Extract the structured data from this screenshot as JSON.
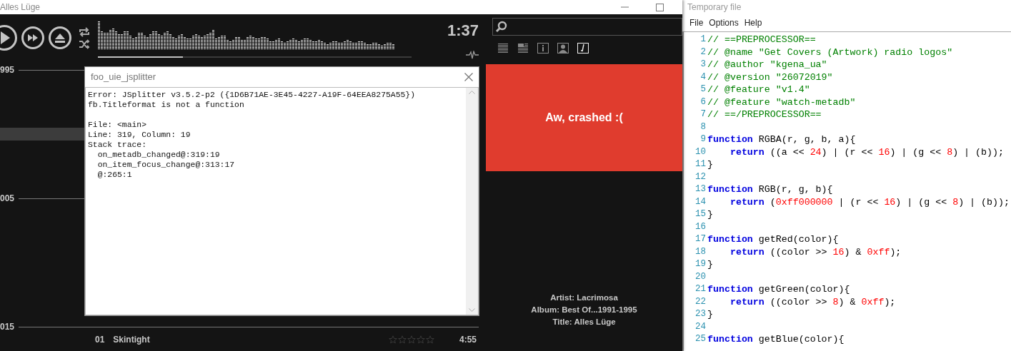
{
  "player": {
    "window_title": "Alles Lüge",
    "time": "1:37",
    "seek": {
      "level": 0.27
    }
  },
  "playlist": [
    {
      "kind": "group",
      "label": "995"
    },
    {
      "kind": "row",
      "selected": true
    },
    {
      "kind": "group",
      "label": "005"
    },
    {
      "kind": "group",
      "label": "015"
    },
    {
      "kind": "track",
      "number": "01",
      "title": "Skintight",
      "stars": 0,
      "duration": "4:55",
      "selected": false
    }
  ],
  "error_dialog": {
    "title": "foo_uie_jsplitter",
    "message": [
      "Error: JSplitter v3.5.2-p2 ({1D6B71AE-3E45-4227-A19F-64EEA8275A55})",
      "fb.Titleformat is not a function"
    ],
    "details": [
      "File: <main>",
      "Line: 319, Column: 19",
      "Stack trace:",
      "  on_metadb_changed@:319:19",
      "  on_item_focus_change@:313:17",
      "  @:265:1"
    ]
  },
  "side_panel": {
    "views": [
      {
        "kind": "list",
        "selected": false
      },
      {
        "kind": "details",
        "selected": false
      },
      {
        "kind": "info",
        "selected": false
      },
      {
        "kind": "artist",
        "selected": false
      },
      {
        "kind": "lyrics",
        "selected": true
      }
    ],
    "crash_message": "Aw, crashed :(",
    "info": [
      "Artist: Lacrimosa",
      "Album: Best Of...1991-1995",
      "Title: Alles Lüge"
    ]
  },
  "editor": {
    "window_title": "Temporary file",
    "menu": [
      "File",
      "Options",
      "Help"
    ],
    "lines": [
      {
        "number": "1",
        "tokens": [
          {
            "kind": "comment",
            "text": "// ==PREPROCESSOR=="
          }
        ]
      },
      {
        "number": "2",
        "tokens": [
          {
            "kind": "comment",
            "text": "// @name \"Get Covers (Artwork) radio logos\""
          }
        ]
      },
      {
        "number": "3",
        "tokens": [
          {
            "kind": "comment",
            "text": "// @author \"kgena_ua\""
          }
        ]
      },
      {
        "number": "4",
        "tokens": [
          {
            "kind": "comment",
            "text": "// @version \"26072019\""
          }
        ]
      },
      {
        "number": "5",
        "tokens": [
          {
            "kind": "comment",
            "text": "// @feature \"v1.4\""
          }
        ]
      },
      {
        "number": "6",
        "tokens": [
          {
            "kind": "comment",
            "text": "// @feature \"watch-metadb\""
          }
        ]
      },
      {
        "number": "7",
        "tokens": [
          {
            "kind": "comment",
            "text": "// ==/PREPROCESSOR=="
          }
        ]
      },
      {
        "number": "8"
      },
      {
        "number": "9",
        "tokens": [
          {
            "kind": "keyword",
            "text": "function"
          },
          {
            "kind": "text",
            "text": " RGBA(r, g, b, a){"
          }
        ]
      },
      {
        "number": "10",
        "tokens": [
          {
            "kind": "keyword",
            "text": "    return"
          },
          {
            "kind": "text",
            "text": " ((a << "
          },
          {
            "kind": "number",
            "text": "24"
          },
          {
            "kind": "text",
            "text": ") | (r << "
          },
          {
            "kind": "number",
            "text": "16"
          },
          {
            "kind": "text",
            "text": ") | (g << "
          },
          {
            "kind": "number",
            "text": "8"
          },
          {
            "kind": "text",
            "text": ") | (b));"
          }
        ]
      },
      {
        "number": "11",
        "tokens": [
          {
            "kind": "text",
            "text": "}"
          }
        ]
      },
      {
        "number": "12"
      },
      {
        "number": "13",
        "tokens": [
          {
            "kind": "keyword",
            "text": "function"
          },
          {
            "kind": "text",
            "text": " RGB(r, g, b){"
          }
        ]
      },
      {
        "number": "14",
        "tokens": [
          {
            "kind": "keyword",
            "text": "    return"
          },
          {
            "kind": "text",
            "text": " ("
          },
          {
            "kind": "number",
            "text": "0xff000000"
          },
          {
            "kind": "text",
            "text": " | (r << "
          },
          {
            "kind": "number",
            "text": "16"
          },
          {
            "kind": "text",
            "text": ") | (g << "
          },
          {
            "kind": "number",
            "text": "8"
          },
          {
            "kind": "text",
            "text": ") | (b));"
          }
        ]
      },
      {
        "number": "15",
        "tokens": [
          {
            "kind": "text",
            "text": "}"
          }
        ]
      },
      {
        "number": "16"
      },
      {
        "number": "17",
        "tokens": [
          {
            "kind": "keyword",
            "text": "function"
          },
          {
            "kind": "text",
            "text": " getRed(color){"
          }
        ]
      },
      {
        "number": "18",
        "tokens": [
          {
            "kind": "keyword",
            "text": "    return"
          },
          {
            "kind": "text",
            "text": " ((color >> "
          },
          {
            "kind": "number",
            "text": "16"
          },
          {
            "kind": "text",
            "text": ") & "
          },
          {
            "kind": "number",
            "text": "0xff"
          },
          {
            "kind": "text",
            "text": ");"
          }
        ]
      },
      {
        "number": "19",
        "tokens": [
          {
            "kind": "text",
            "text": "}"
          }
        ]
      },
      {
        "number": "20"
      },
      {
        "number": "21",
        "tokens": [
          {
            "kind": "keyword",
            "text": "function"
          },
          {
            "kind": "text",
            "text": " getGreen(color){"
          }
        ]
      },
      {
        "number": "22",
        "tokens": [
          {
            "kind": "keyword",
            "text": "    return"
          },
          {
            "kind": "text",
            "text": " ((color >> "
          },
          {
            "kind": "number",
            "text": "8"
          },
          {
            "kind": "text",
            "text": ") & "
          },
          {
            "kind": "number",
            "text": "0xff"
          },
          {
            "kind": "text",
            "text": ");"
          }
        ]
      },
      {
        "number": "23",
        "tokens": [
          {
            "kind": "text",
            "text": "}"
          }
        ]
      },
      {
        "number": "24"
      },
      {
        "number": "25",
        "tokens": [
          {
            "kind": "keyword",
            "text": "function"
          },
          {
            "kind": "text",
            "text": " getBlue(color){"
          }
        ]
      }
    ]
  }
}
